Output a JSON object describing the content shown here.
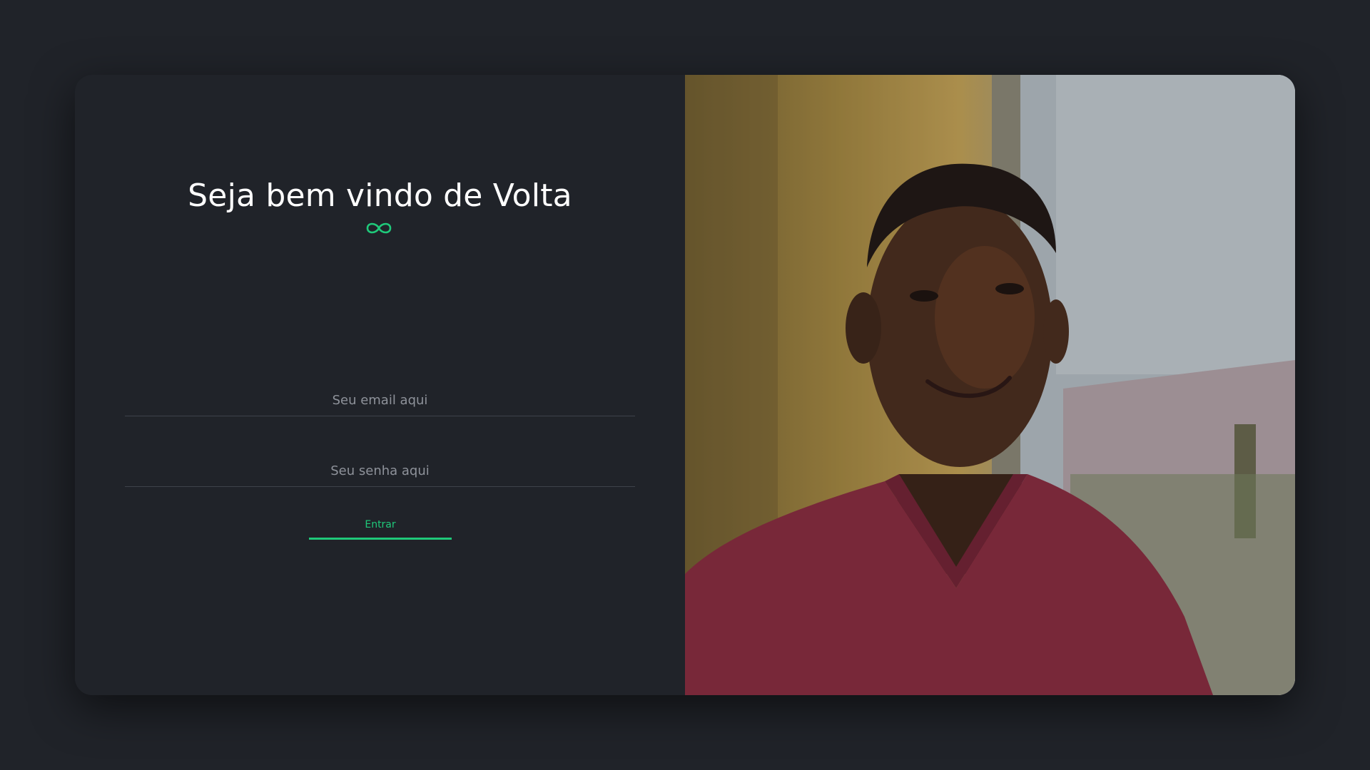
{
  "login": {
    "title": "Seja bem vindo de Volta",
    "email_placeholder": "Seu email aqui",
    "password_placeholder": "Seu senha aqui",
    "submit_label": "Entrar",
    "logo_icon": "infinity-icon"
  },
  "colors": {
    "background": "#202329",
    "accent": "#1fc97a",
    "text": "#ffffff"
  }
}
